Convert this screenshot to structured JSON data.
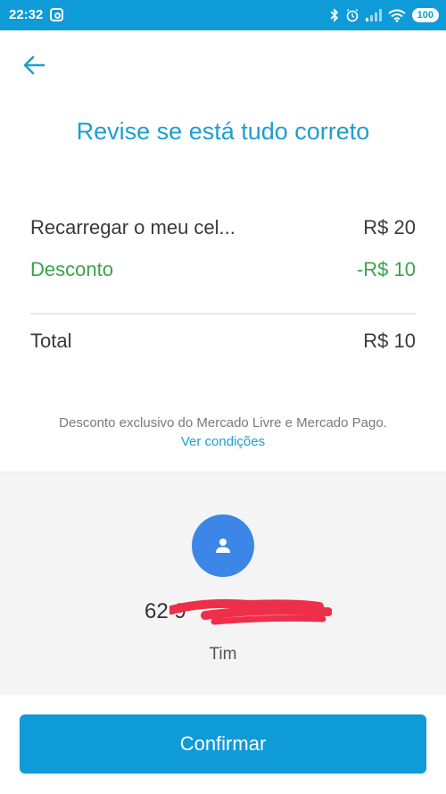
{
  "status_bar": {
    "time": "22:32",
    "battery": "100",
    "icons": [
      "instagram-icon",
      "bluetooth-icon",
      "alarm-icon",
      "signal-icon",
      "wifi-icon",
      "battery-icon"
    ]
  },
  "header": {
    "back_icon": "arrow-left-icon",
    "title": "Revise se está tudo correto"
  },
  "summary": {
    "item_label": "Recarregar o meu cel...",
    "item_value": "R$ 20",
    "discount_label": "Desconto",
    "discount_value": "-R$ 10",
    "total_label": "Total",
    "total_value": "R$ 10"
  },
  "disclaimer": {
    "text": "Desconto exclusivo do Mercado Livre e Mercado Pago.",
    "link": "Ver condições"
  },
  "contact": {
    "avatar_icon": "person-icon",
    "phone_visible": "62 9",
    "carrier": "Tim"
  },
  "actions": {
    "confirm_label": "Confirmar"
  },
  "colors": {
    "brand": "#0f9ad8",
    "title": "#1e9ed0",
    "discount": "#3aa34a",
    "avatar": "#3b86e6",
    "panel": "#f4f4f4"
  }
}
